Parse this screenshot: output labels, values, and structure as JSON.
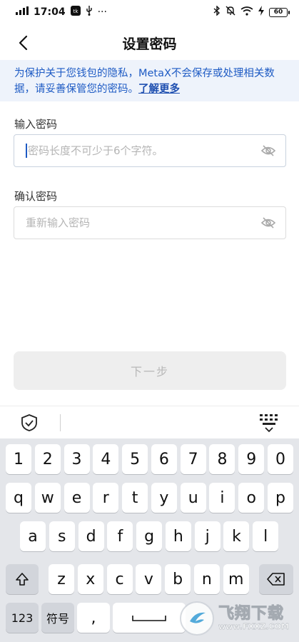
{
  "status": {
    "time": "17:04",
    "signal": "signal-bars-icon",
    "battery": "60",
    "extra": "···"
  },
  "nav": {
    "title": "设置密码"
  },
  "notice": {
    "text": "为保护关于您钱包的隐私，MetaX不会保存或处理相关数据，请妥善保管您的密码。",
    "link": "了解更多"
  },
  "form": {
    "password_label": "输入密码",
    "password_placeholder": "密码长度不可少于6个字符。",
    "confirm_label": "确认密码",
    "confirm_placeholder": "重新输入密码"
  },
  "next_label": "下一步",
  "keyboard": {
    "row_numbers": [
      "1",
      "2",
      "3",
      "4",
      "5",
      "6",
      "7",
      "8",
      "9",
      "0"
    ],
    "row1": [
      "q",
      "w",
      "e",
      "r",
      "t",
      "y",
      "u",
      "i",
      "o",
      "p"
    ],
    "row2": [
      "a",
      "s",
      "d",
      "f",
      "g",
      "h",
      "j",
      "k",
      "l"
    ],
    "row3": [
      "z",
      "x",
      "c",
      "v",
      "b",
      "n",
      "m"
    ],
    "key_123": "123",
    "key_symbols": "符号",
    "key_comma": ","
  },
  "watermark": {
    "text": "飞翔下载",
    "url": "www.FXXZ.COM"
  },
  "colors": {
    "accent": "#1e5bc4",
    "notice_bg": "#eef3fb",
    "keyboard_bg": "#e4e6ea"
  }
}
